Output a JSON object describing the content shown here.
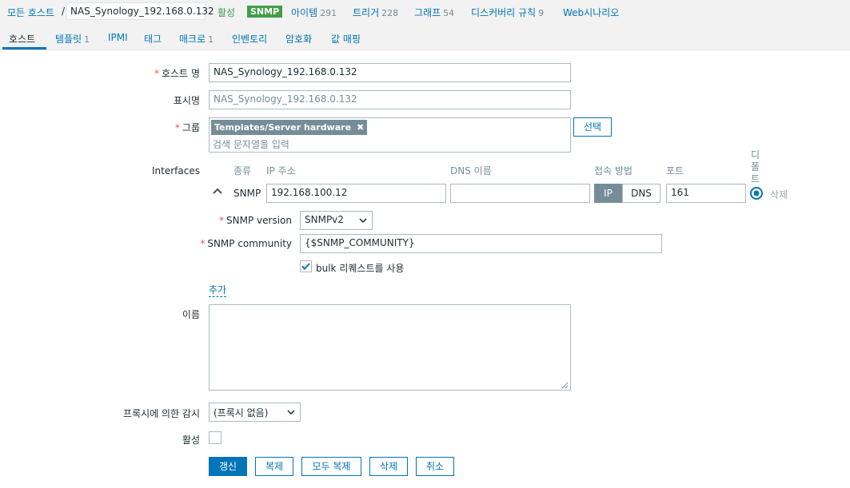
{
  "breadcrumb": {
    "all_hosts": "모든 호스트",
    "separator": "/",
    "host": "NAS_Synology_192.168.0.132",
    "status": "활성",
    "snmp_badge": "SNMP",
    "items_label": "아이템",
    "items_count": "291",
    "triggers_label": "트리거",
    "triggers_count": "228",
    "graphs_label": "그래프",
    "graphs_count": "54",
    "discovery_label": "디스커버리 규칙",
    "discovery_count": "9",
    "web_label": "Web시나리오"
  },
  "tabs": [
    {
      "label": "호스트",
      "count": ""
    },
    {
      "label": "템플릿",
      "count": "1"
    },
    {
      "label": "IPMI",
      "count": ""
    },
    {
      "label": "태그",
      "count": ""
    },
    {
      "label": "매크로",
      "count": "1"
    },
    {
      "label": "인벤토리",
      "count": ""
    },
    {
      "label": "암호화",
      "count": ""
    },
    {
      "label": "값 매핑",
      "count": ""
    }
  ],
  "form": {
    "host_name_label": "호스트 명",
    "host_name_value": "NAS_Synology_192.168.0.132",
    "visible_name_label": "표시명",
    "visible_name_placeholder": "NAS_Synology_192.168.0.132",
    "groups_label": "그룹",
    "group_chip": "Templates/Server hardware",
    "group_search_placeholder": "검색 문자열을 입력",
    "select_button": "선택",
    "interfaces_label": "Interfaces",
    "if_headers": {
      "type": "종류",
      "ip": "IP 주소",
      "dns": "DNS 이름",
      "connect": "접속 방법",
      "port": "포트",
      "default": "디폴트"
    },
    "interface": {
      "type": "SNMP",
      "ip": "192.168.100.12",
      "dns": "",
      "connect_ip": "IP",
      "connect_dns": "DNS",
      "port": "161",
      "remove": "삭제"
    },
    "snmp_version_label": "SNMP version",
    "snmp_version_value": "SNMPv2",
    "snmp_community_label": "SNMP community",
    "snmp_community_value": "{$SNMP_COMMUNITY}",
    "bulk_label": "bulk 리퀘스트를 사용",
    "bulk_checked": true,
    "add_link": "추가",
    "description_label": "이름",
    "proxy_label": "프록시에 의한 감시",
    "proxy_value": "(프록시 없음)",
    "enabled_label": "활성",
    "enabled_checked": false
  },
  "buttons": {
    "update": "갱신",
    "clone": "복제",
    "full_clone": "모두 복제",
    "delete": "삭제",
    "cancel": "취소"
  },
  "colors": {
    "accent": "#0275b8",
    "active": "#429e47",
    "required": "#e45959"
  }
}
